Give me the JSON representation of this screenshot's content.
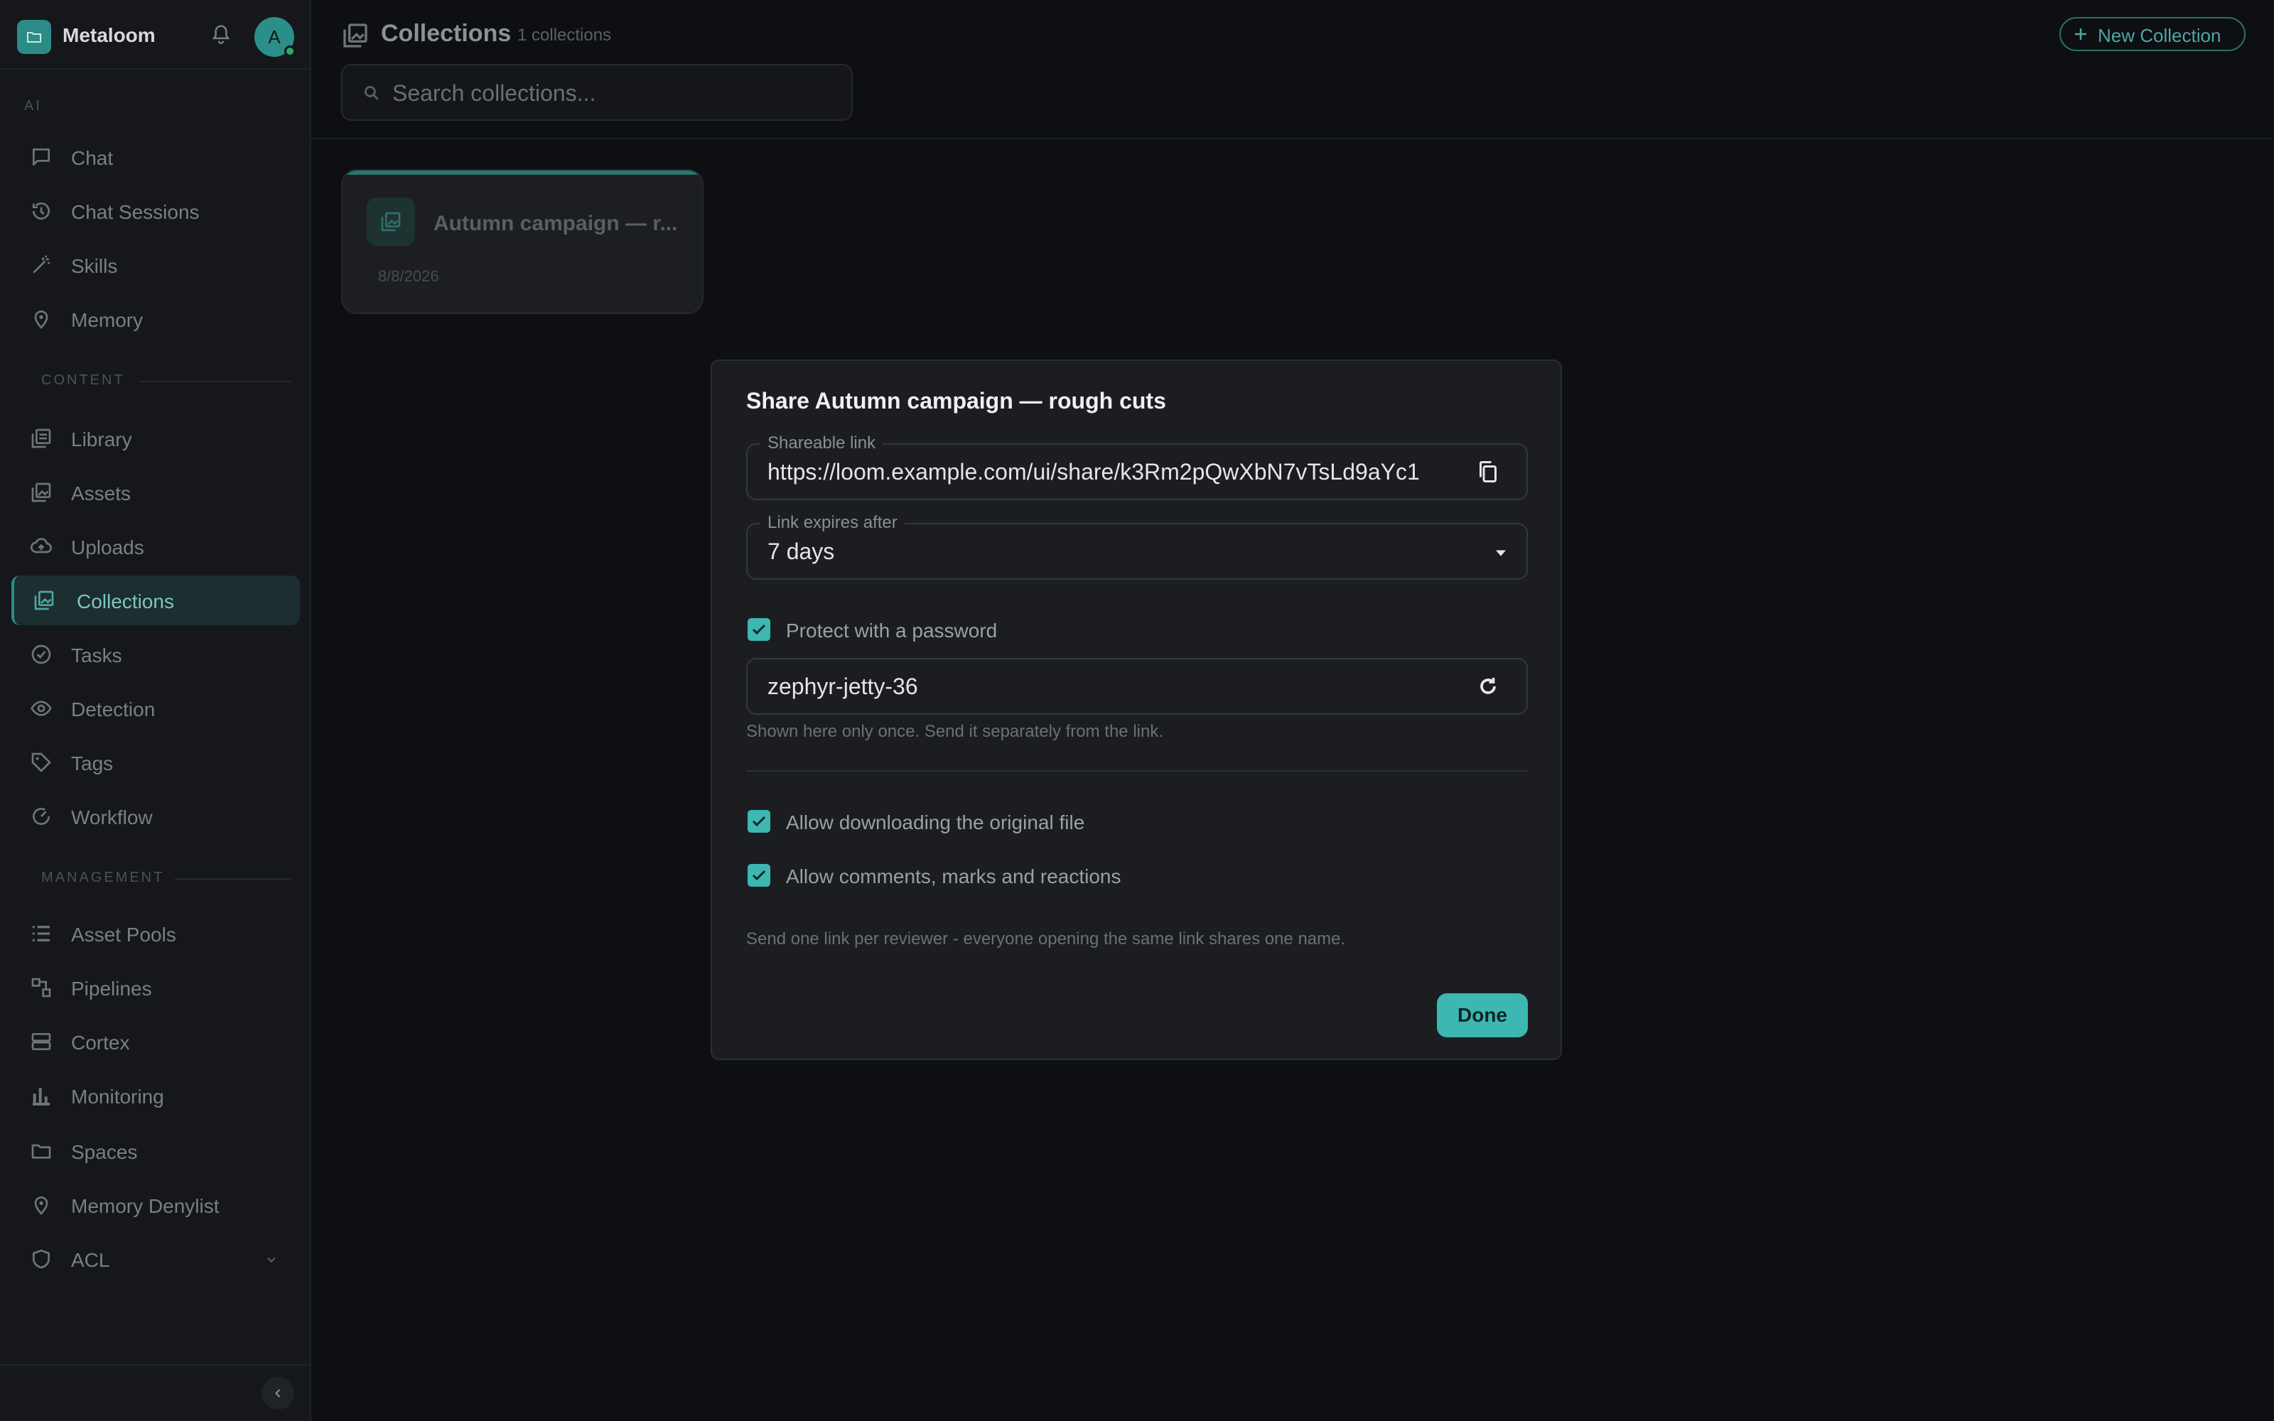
{
  "app": {
    "name": "Metaloom",
    "avatar_initial": "A"
  },
  "sidebar": {
    "sections": [
      {
        "label": "AI"
      },
      {
        "label": "CONTENT"
      },
      {
        "label": "MANAGEMENT"
      }
    ],
    "items": [
      {
        "label": "Chat",
        "icon": "chat-bubble-icon"
      },
      {
        "label": "Chat Sessions",
        "icon": "history-icon"
      },
      {
        "label": "Skills",
        "icon": "magic-wand-icon"
      },
      {
        "label": "Memory",
        "icon": "memory-pin-icon"
      },
      {
        "label": "Library",
        "icon": "library-icon"
      },
      {
        "label": "Assets",
        "icon": "image-stack-icon"
      },
      {
        "label": "Uploads",
        "icon": "cloud-upload-icon"
      },
      {
        "label": "Collections",
        "icon": "collections-icon",
        "active": true
      },
      {
        "label": "Tasks",
        "icon": "task-check-icon"
      },
      {
        "label": "Detection",
        "icon": "eye-icon"
      },
      {
        "label": "Tags",
        "icon": "tag-icon"
      },
      {
        "label": "Workflow",
        "icon": "workflow-icon"
      },
      {
        "label": "Asset Pools",
        "icon": "list-icon"
      },
      {
        "label": "Pipelines",
        "icon": "pipeline-icon"
      },
      {
        "label": "Cortex",
        "icon": "server-icon"
      },
      {
        "label": "Monitoring",
        "icon": "bar-chart-icon"
      },
      {
        "label": "Spaces",
        "icon": "folder-icon"
      },
      {
        "label": "Memory Denylist",
        "icon": "memory-pin-icon"
      },
      {
        "label": "ACL",
        "icon": "shield-icon"
      }
    ]
  },
  "header": {
    "title": "Collections",
    "count": "1 collections",
    "new_button": "New Collection",
    "search_placeholder": "Search collections..."
  },
  "collections": [
    {
      "title": "Autumn campaign — r...",
      "date": "8/8/2026"
    }
  ],
  "modal": {
    "title": "Share Autumn campaign — rough cuts",
    "link_label": "Shareable link",
    "link_value": "https://loom.example.com/ui/share/k3Rm2pQwXbN7vTsLd9aYc1",
    "expires_label": "Link expires after",
    "expires_value": "7 days",
    "password_checkbox": "Protect with a password",
    "password_checked": true,
    "password_value": "zephyr-jetty-36",
    "password_helper": "Shown here only once. Send it separately from the link.",
    "download_checkbox": "Allow downloading the original file",
    "download_checked": true,
    "comments_checkbox": "Allow comments, marks and reactions",
    "comments_checked": true,
    "footer_note": "Send one link per reviewer - everyone opening the same link shares one name.",
    "done_button": "Done"
  },
  "colors": {
    "accent": "#3db7b1",
    "accent_dark": "#2a8f88",
    "background": "#0d0f12",
    "modal_bg": "#1b1d21"
  }
}
